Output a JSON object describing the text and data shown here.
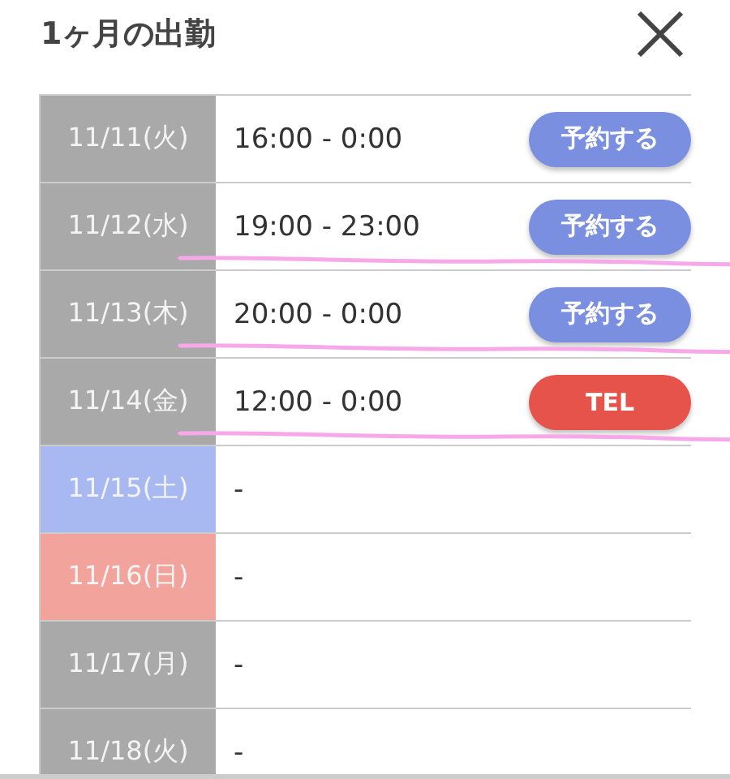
{
  "title": "1ヶ月の出勤",
  "rows": [
    {
      "date": "11/11(火)",
      "color": "#a9a9a9",
      "time": "16:00 - 0:00",
      "button": {
        "label": "予約する",
        "kind": "reserve"
      },
      "crossed_out": false
    },
    {
      "date": "11/12(水)",
      "color": "#a9a9a9",
      "time": "19:00 - 23:00",
      "button": {
        "label": "予約する",
        "kind": "reserve"
      },
      "crossed_out": true
    },
    {
      "date": "11/13(木)",
      "color": "#a9a9a9",
      "time": "20:00 - 0:00",
      "button": {
        "label": "予約する",
        "kind": "reserve"
      },
      "crossed_out": true
    },
    {
      "date": "11/14(金)",
      "color": "#a9a9a9",
      "time": "12:00 - 0:00",
      "button": {
        "label": "TEL",
        "kind": "tel"
      },
      "crossed_out": true
    },
    {
      "date": "11/15(土)",
      "color": "#a8b8f0",
      "time": "-",
      "crossed_out": false
    },
    {
      "date": "11/16(日)",
      "color": "#f2a49c",
      "time": "-",
      "crossed_out": false
    },
    {
      "date": "11/17(月)",
      "color": "#a9a9a9",
      "time": "-",
      "crossed_out": false
    },
    {
      "date": "11/18(火)",
      "color": "#a9a9a9",
      "time": "-",
      "crossed_out": false
    }
  ]
}
